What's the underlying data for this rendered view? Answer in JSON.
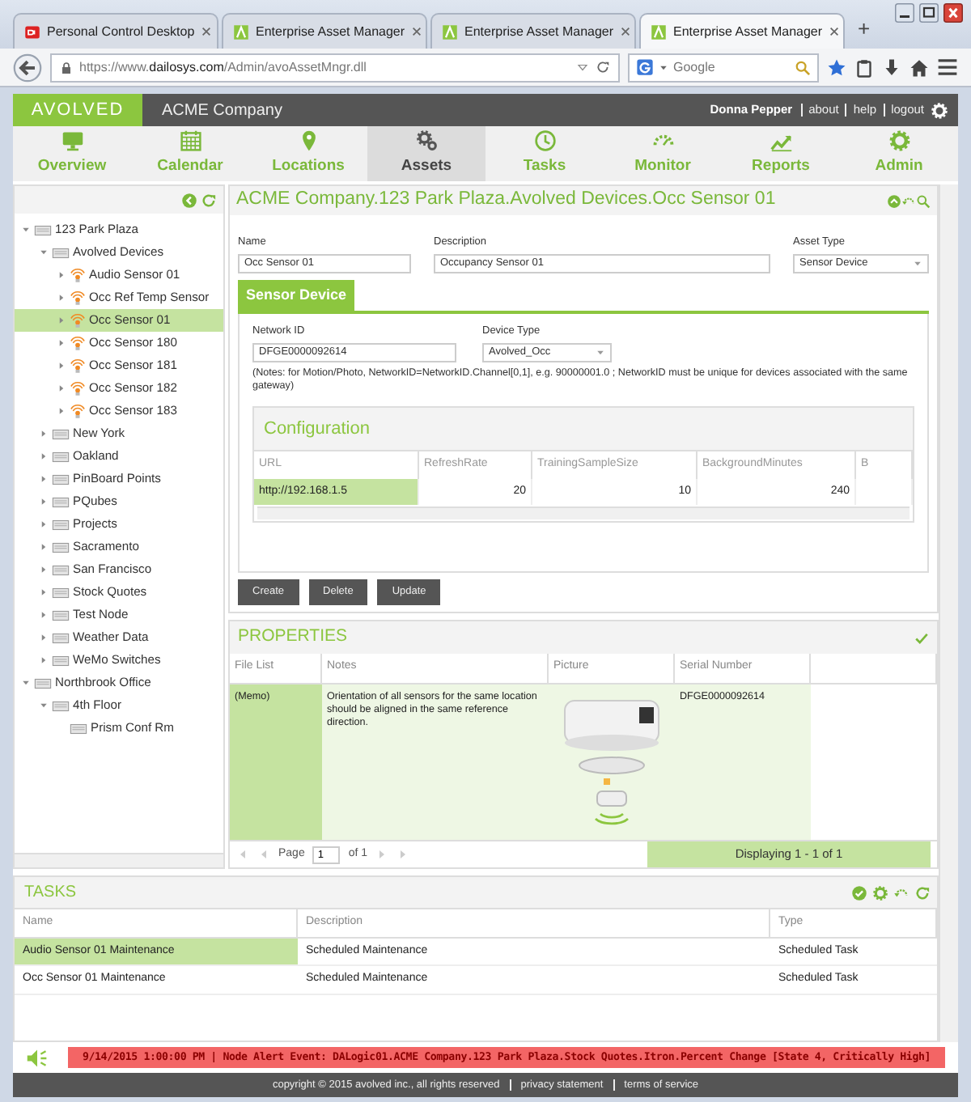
{
  "browser": {
    "tabs": [
      {
        "title": "Personal Control Desktop",
        "kind": "pcd",
        "selected": false
      },
      {
        "title": "Enterprise Asset Manager",
        "kind": "eam",
        "selected": false
      },
      {
        "title": "Enterprise Asset Manager",
        "kind": "eam",
        "selected": false
      },
      {
        "title": "Enterprise Asset Manager",
        "kind": "eam",
        "selected": true
      }
    ],
    "new_tab": "+",
    "address": "https://www.**dailosys.com**/Admin/avoAssetMngr.dll",
    "search": {
      "placeholder": "Google"
    }
  },
  "header": {
    "logo": "AVOLVED",
    "company": "ACME Company",
    "user": "Donna Pepper",
    "links": [
      "about",
      "help",
      "logout"
    ]
  },
  "nav": [
    {
      "label": "Overview",
      "kind": "monitor",
      "selected": false
    },
    {
      "label": "Calendar",
      "kind": "calendar",
      "selected": false
    },
    {
      "label": "Locations",
      "kind": "pin",
      "selected": false
    },
    {
      "label": "Assets",
      "kind": "gears",
      "selected": true
    },
    {
      "label": "Tasks",
      "kind": "clock",
      "selected": false
    },
    {
      "label": "Monitor",
      "kind": "gauge",
      "selected": false
    },
    {
      "label": "Reports",
      "kind": "chart",
      "selected": false
    },
    {
      "label": "Admin",
      "kind": "gear",
      "selected": false
    }
  ],
  "tree": {
    "items": [
      {
        "label": "123 Park Plaza",
        "kind": "folder",
        "expanded": true,
        "selected": false,
        "children": [
          {
            "label": "Avolved Devices",
            "kind": "folder",
            "expanded": true,
            "selected": false,
            "children": [
              {
                "label": "Audio Sensor 01",
                "kind": "sensor",
                "expanded": false,
                "selected": false
              },
              {
                "label": "Occ Ref Temp Sensor",
                "kind": "sensor",
                "expanded": false,
                "selected": false
              },
              {
                "label": "Occ Sensor 01",
                "kind": "sensor",
                "expanded": false,
                "selected": true
              },
              {
                "label": "Occ Sensor 180",
                "kind": "sensor",
                "expanded": false,
                "selected": false
              },
              {
                "label": "Occ Sensor 181",
                "kind": "sensor",
                "expanded": false,
                "selected": false
              },
              {
                "label": "Occ Sensor 182",
                "kind": "sensor",
                "expanded": false,
                "selected": false
              },
              {
                "label": "Occ Sensor 183",
                "kind": "sensor",
                "expanded": false,
                "selected": false
              }
            ]
          },
          {
            "label": "New York",
            "kind": "folder",
            "expanded": false,
            "selected": false
          },
          {
            "label": "Oakland",
            "kind": "folder",
            "expanded": false,
            "selected": false
          },
          {
            "label": "PinBoard Points",
            "kind": "folder",
            "expanded": false,
            "selected": false
          },
          {
            "label": "PQubes",
            "kind": "folder",
            "expanded": false,
            "selected": false
          },
          {
            "label": "Projects",
            "kind": "folder",
            "expanded": false,
            "selected": false
          },
          {
            "label": "Sacramento",
            "kind": "folder",
            "expanded": false,
            "selected": false
          },
          {
            "label": "San Francisco",
            "kind": "folder",
            "expanded": false,
            "selected": false
          },
          {
            "label": "Stock Quotes",
            "kind": "folder",
            "expanded": false,
            "selected": false
          },
          {
            "label": "Test Node",
            "kind": "folder",
            "expanded": false,
            "selected": false
          },
          {
            "label": "Weather Data",
            "kind": "folder",
            "expanded": false,
            "selected": false
          },
          {
            "label": "WeMo Switches",
            "kind": "folder",
            "expanded": false,
            "selected": false
          }
        ]
      },
      {
        "label": "Northbrook Office",
        "kind": "folder",
        "expanded": true,
        "selected": false,
        "children": [
          {
            "label": "4th Floor",
            "kind": "folder",
            "expanded": true,
            "selected": false,
            "children": [
              {
                "label": "Prism Conf Rm",
                "kind": "folder",
                "selected": false
              }
            ]
          }
        ]
      }
    ]
  },
  "asset": {
    "title": "ACME Company.123 Park Plaza.Avolved Devices.Occ Sensor 01",
    "fields": [
      {
        "label": "Name",
        "value": "Occ Sensor 01",
        "kind": "text"
      },
      {
        "label": "Description",
        "value": "Occupancy Sensor 01",
        "kind": "text"
      },
      {
        "label": "Asset Type",
        "value": "Sensor Device",
        "kind": "select"
      }
    ],
    "tab": "Sensor Device",
    "device_fields": [
      {
        "label": "Network ID",
        "value": "DFGE0000092614",
        "kind": "text"
      },
      {
        "label": "Device Type",
        "value": "Avolved_Occ",
        "kind": "select"
      }
    ],
    "note": "(Notes: for Motion/Photo, NetworkID=NetworkID.Channel[0,1], e.g. 90000001.0 ; NetworkID must be unique for devices associated with the same gateway)",
    "configuration": {
      "title": "Configuration",
      "columns": [
        "URL",
        "RefreshRate",
        "TrainingSampleSize",
        "BackgroundMinutes",
        "B"
      ],
      "rows": [
        {
          "cells": [
            "http://192.168.1.5",
            "20",
            "10",
            "240"
          ],
          "selected": true
        }
      ]
    },
    "buttons": [
      "Create",
      "Delete",
      "Update"
    ]
  },
  "properties": {
    "title": "PROPERTIES",
    "columns": [
      "File List",
      "Notes",
      "Picture",
      "Serial Number"
    ],
    "rows": [
      {
        "file_list": "(Memo)",
        "notes": "Orientation of all sensors for the same location should be aligned in the same reference direction.",
        "serial_number": "DFGE0000092614",
        "selected": true
      }
    ],
    "pager": {
      "label": "Page",
      "page": "1",
      "of": "of 1",
      "display": "Displaying 1 - 1 of 1"
    }
  },
  "tasks": {
    "title": "TASKS",
    "columns": [
      "Name",
      "Description",
      "Type"
    ],
    "rows": [
      {
        "cells": [
          "Audio Sensor 01 Maintenance",
          "Scheduled Maintenance",
          "Scheduled Task"
        ],
        "selected": true
      },
      {
        "cells": [
          "Occ Sensor 01 Maintenance",
          "Scheduled Maintenance",
          "Scheduled Task"
        ],
        "selected": false
      }
    ]
  },
  "alert": "9/14/2015 1:00:00 PM | Node Alert Event: DALogic01.ACME Company.123 Park Plaza.Stock Quotes.Itron.Percent Change [State 4, Critically High]",
  "footer": [
    "copyright © 2015 avolved inc., all rights reserved",
    "privacy statement",
    "terms of service"
  ]
}
